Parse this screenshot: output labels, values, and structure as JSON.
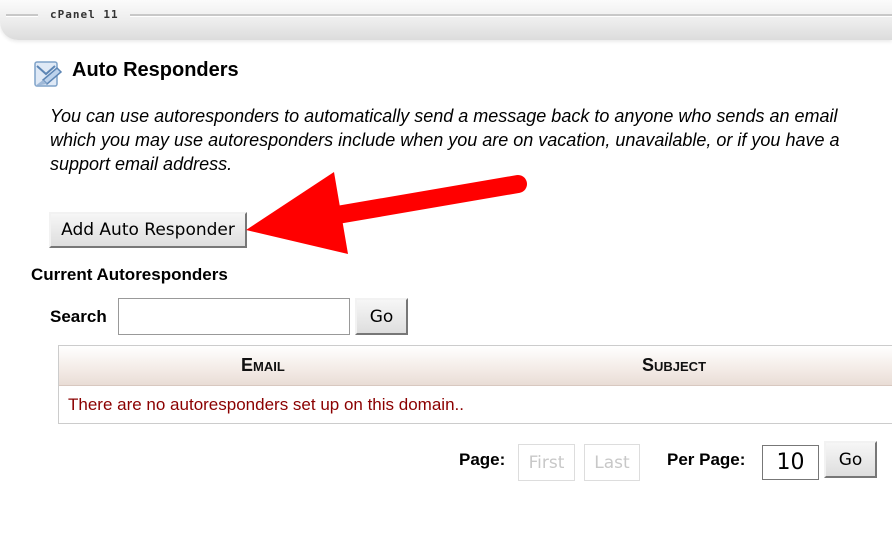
{
  "header": {
    "brand": "cPanel 11"
  },
  "page": {
    "title": "Auto Responders"
  },
  "description": {
    "lines": [
      "You can use autoresponders to automatically send a message back to anyone who sends an email",
      "which you may use autoresponders include when you are on vacation, unavailable, or if you have a",
      "support email address."
    ]
  },
  "actions": {
    "add_label": "Add Auto Responder"
  },
  "current": {
    "title": "Current Autoresponders"
  },
  "search": {
    "label": "Search",
    "value": "",
    "go_label": "Go"
  },
  "table": {
    "columns": [
      "Email",
      "Subject"
    ],
    "empty_message": "There are no autoresponders set up on this domain.."
  },
  "pagination": {
    "page_label": "Page:",
    "first_label": "First",
    "last_label": "Last",
    "per_page_label": "Per Page:",
    "per_page_value": "10",
    "go_label": "Go"
  },
  "colors": {
    "arrow": "#ff0000",
    "empty_text": "#8b0000"
  },
  "icons": [
    "autoresponder-icon",
    "red-arrow-annotation"
  ]
}
